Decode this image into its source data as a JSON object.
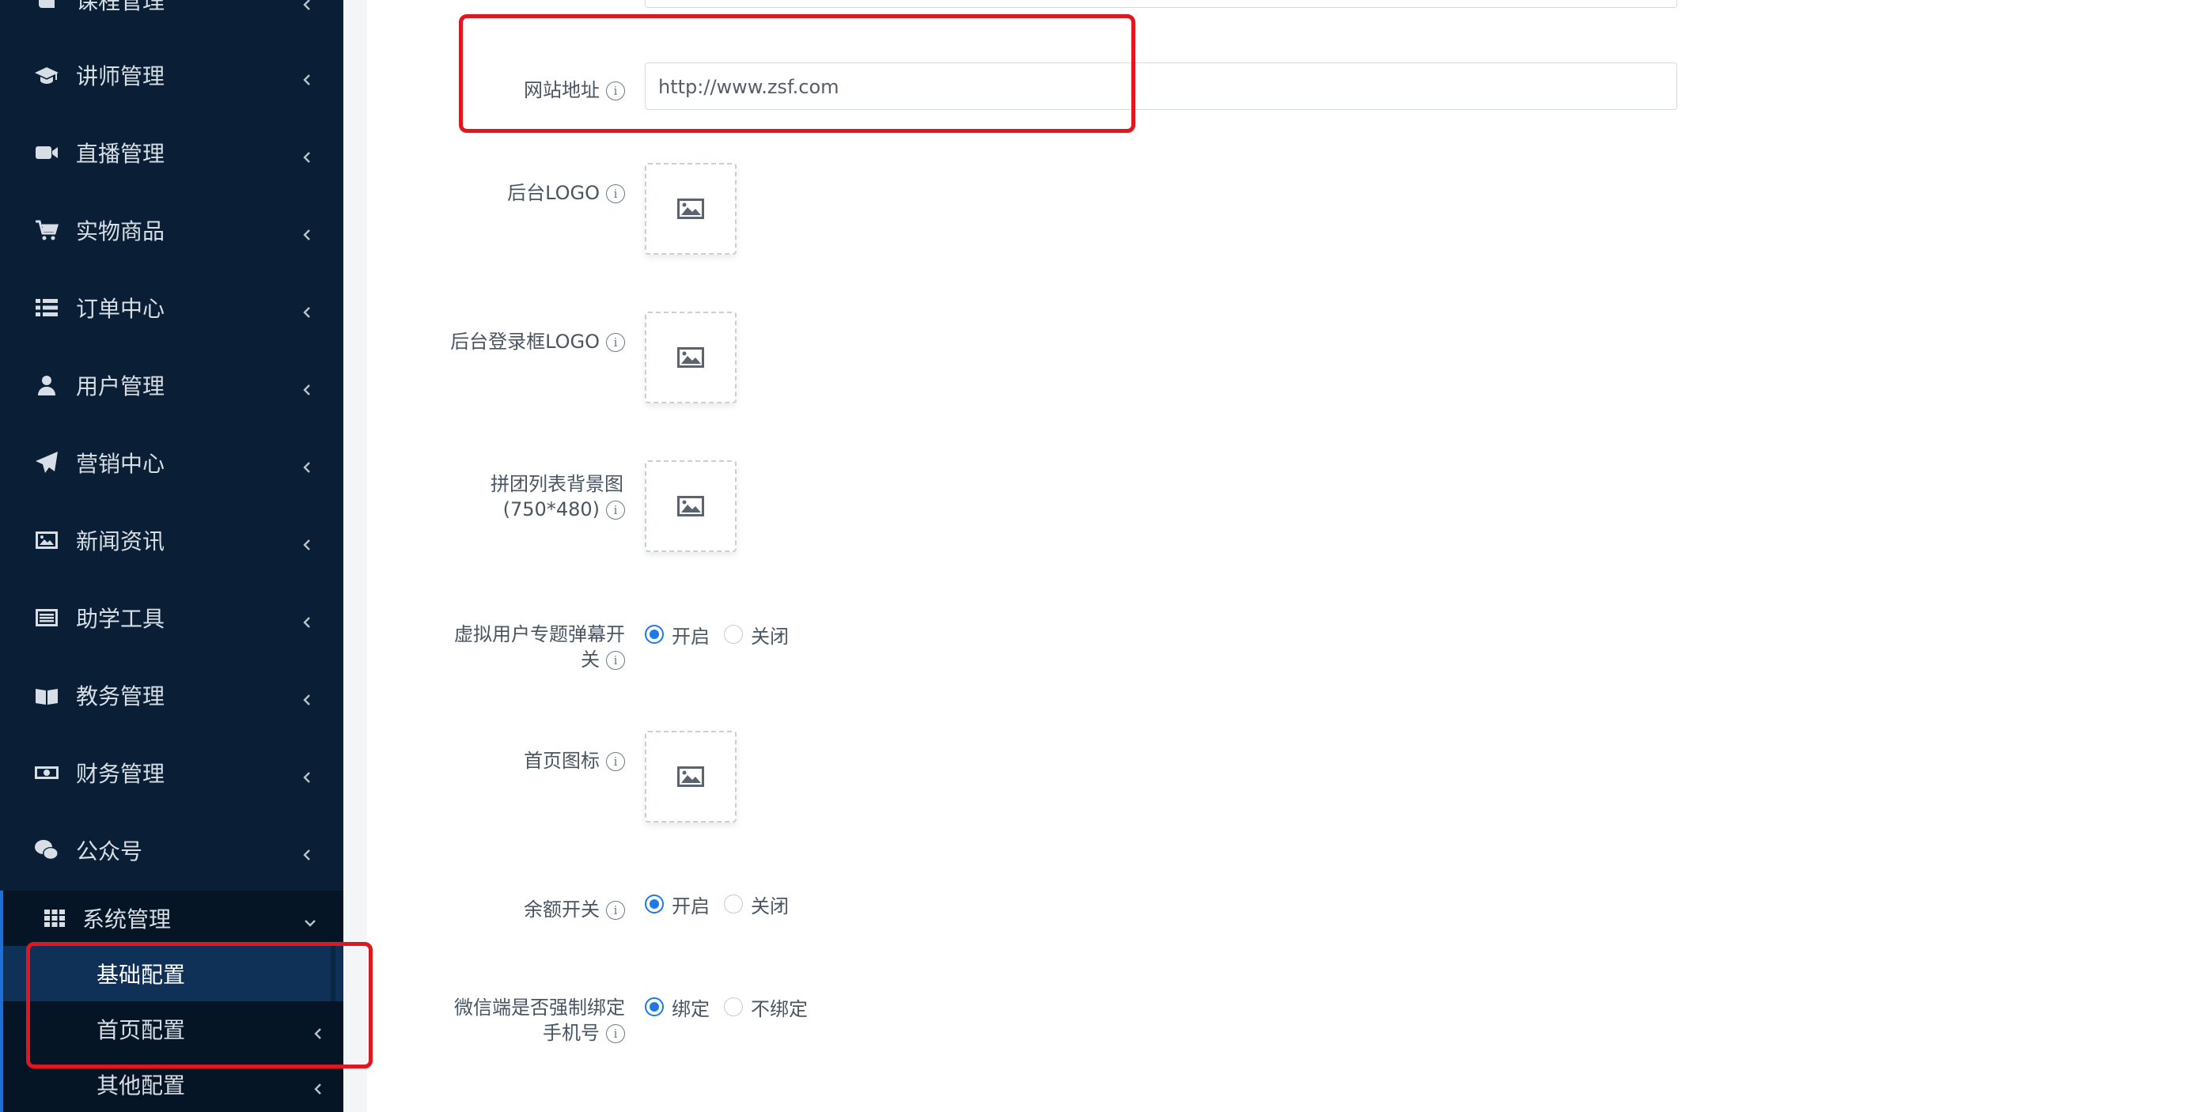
{
  "sidebar": {
    "items": [
      {
        "label": "课程管理",
        "icon": "book-icon"
      },
      {
        "label": "讲师管理",
        "icon": "graduation-cap-icon"
      },
      {
        "label": "直播管理",
        "icon": "video-camera-icon"
      },
      {
        "label": "实物商品",
        "icon": "shopping-cart-icon"
      },
      {
        "label": "订单中心",
        "icon": "list-icon"
      },
      {
        "label": "用户管理",
        "icon": "user-icon"
      },
      {
        "label": "营销中心",
        "icon": "paper-plane-icon"
      },
      {
        "label": "新闻资讯",
        "icon": "image-icon"
      },
      {
        "label": "助学工具",
        "icon": "tool-list-icon"
      },
      {
        "label": "教务管理",
        "icon": "open-book-icon"
      },
      {
        "label": "财务管理",
        "icon": "money-icon"
      },
      {
        "label": "公众号",
        "icon": "wechat-icon"
      }
    ],
    "open_group": {
      "label": "系统管理",
      "icon": "grid-icon",
      "children": [
        {
          "label": "基础配置",
          "active": true
        },
        {
          "label": "首页配置",
          "active": false
        },
        {
          "label": "其他配置",
          "active": false
        }
      ]
    }
  },
  "form": {
    "website": {
      "label": "网站地址",
      "value": "http://www.zsf.com"
    },
    "admin_logo": {
      "label": "后台LOGO"
    },
    "login_logo": {
      "label": "后台登录框LOGO"
    },
    "group_bg": {
      "label_line1": "拼团列表背景图",
      "label_line2": "(750*480)"
    },
    "virtual_barrage": {
      "label_line1": "虚拟用户专题弹幕开",
      "label_line2": "关",
      "options": [
        "开启",
        "关闭"
      ],
      "selected": "开启"
    },
    "home_icon": {
      "label": "首页图标"
    },
    "balance": {
      "label": "余额开关",
      "options": [
        "开启",
        "关闭"
      ],
      "selected": "开启"
    },
    "wechat_bind": {
      "label_line1": "微信端是否强制绑定",
      "label_line2": "手机号",
      "options": [
        "绑定",
        "不绑定"
      ],
      "selected": "绑定"
    }
  },
  "colors": {
    "sidebar_bg": "#0a1f35",
    "accent": "#1e78e6",
    "annotation": "#e2161f"
  }
}
